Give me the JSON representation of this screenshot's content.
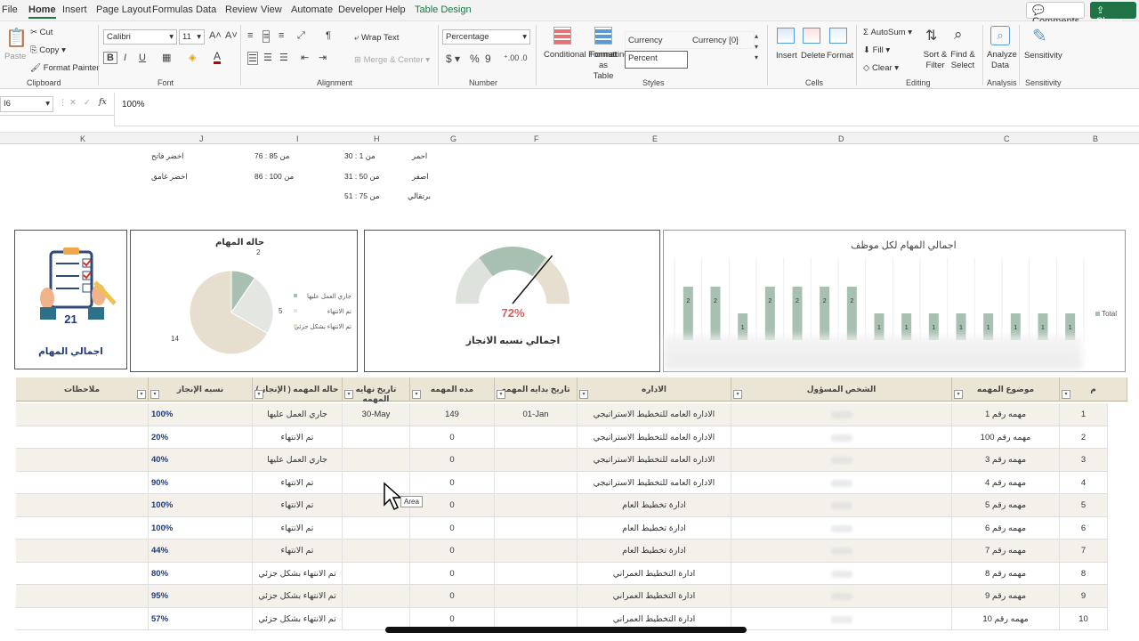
{
  "menu": {
    "tabs": [
      "File",
      "Home",
      "Insert",
      "Page Layout",
      "Formulas",
      "Data",
      "Review",
      "View",
      "Automate",
      "Developer",
      "Help",
      "Table Design"
    ],
    "comments": "Comments",
    "share": "Share"
  },
  "ribbon": {
    "clipboard": {
      "paste": "Paste",
      "cut": "Cut",
      "copy": "Copy",
      "format_painter": "Format Painter",
      "label": "Clipboard"
    },
    "font": {
      "name": "Calibri",
      "size": "11",
      "label": "Font"
    },
    "alignment": {
      "wrap": "Wrap Text",
      "merge": "Merge & Center",
      "label": "Alignment"
    },
    "number": {
      "format": "Percentage",
      "label": "Number"
    },
    "styles": {
      "conditional": "Conditional Formatting",
      "format_table": "Format as Table",
      "currency": "Currency",
      "currency0": "Currency [0]",
      "percent": "Percent",
      "label": "Styles"
    },
    "cells": {
      "insert": "Insert",
      "delete": "Delete",
      "format": "Format",
      "label": "Cells"
    },
    "editing": {
      "autosum": "AutoSum",
      "fill": "Fill",
      "clear": "Clear",
      "sort": "Sort & Filter",
      "find": "Find & Select",
      "label": "Editing"
    },
    "analysis": {
      "analyze": "Analyze Data",
      "label": "Analysis"
    },
    "sensitivity": {
      "btn": "Sensitivity",
      "label": "Sensitivity"
    }
  },
  "formula_bar": {
    "name_box": "I6",
    "fx": "fx",
    "value": "100%"
  },
  "columns": [
    "K",
    "J",
    "I",
    "H",
    "G",
    "F",
    "E",
    "D",
    "C",
    "B"
  ],
  "legend_ranges": {
    "red_label": "احمر",
    "red_range": "من 1 : 30",
    "yellow_label": "اصفر",
    "yellow_range": "من 50 : 31",
    "orange_label": "برتقالي",
    "orange_range": "من 75 : 51",
    "lightgreen_range": "من 85 : 76",
    "lightgreen_label": "اخضر فاتح",
    "darkgreen_range": "من 100 : 86",
    "darkgreen_label": "اخضر غامق"
  },
  "dashboard": {
    "total_tasks_value": "21",
    "total_tasks_label": "اجمالي المهام",
    "gauge_value": "72%",
    "gauge_title": "اجمالي نسبه الانجاز",
    "gauge_fraction": 0.72
  },
  "chart_data": [
    {
      "type": "pie",
      "title": "حاله المهام",
      "slices": [
        {
          "name": "جاري العمل عليها",
          "value": 2,
          "color": "#a8c0b2"
        },
        {
          "name": "تم الانتهاء",
          "value": 5,
          "color": "#e3e6e1"
        },
        {
          "name": "تم الانتهاء بشكل جزئي",
          "value": 14,
          "color": "#e6dfcf"
        }
      ]
    },
    {
      "type": "bar",
      "title": "اجمالي المهام لكل موظف",
      "series": [
        {
          "name": "Total",
          "values": [
            2,
            2,
            1,
            2,
            2,
            2,
            2,
            1,
            1,
            1,
            1,
            1,
            1,
            1,
            1
          ]
        }
      ],
      "color": "#a8c0b2"
    }
  ],
  "table": {
    "headers": {
      "notes": "ملاحظات",
      "pct": "نسبه الإنجاز",
      "status": "حاله المهمه ( الإنجاز )",
      "end": "تاريخ نهايه المهمه",
      "duration": "مده المهمه",
      "start": "تاريخ بدايه المهمه",
      "dept": "الاداره",
      "person": "الشخص المسؤول",
      "subject": "موضوع المهمه",
      "num": "م"
    },
    "rows": [
      {
        "pct": "100%",
        "status": "جاري العمل عليها",
        "end": "30-May",
        "duration": "149",
        "start": "01-Jan",
        "dept": "الاداره العامه للتخطيط الاستراتيجي",
        "subject": "مهمه رقم 1",
        "num": "1"
      },
      {
        "pct": "20%",
        "status": "تم الانتهاء",
        "end": "",
        "duration": "0",
        "start": "",
        "dept": "الاداره العامه للتخطيط الاستراتيجي",
        "subject": "مهمه رقم 100",
        "num": "2"
      },
      {
        "pct": "40%",
        "status": "جاري العمل عليها",
        "end": "",
        "duration": "0",
        "start": "",
        "dept": "الاداره العامه للتخطيط الاستراتيجي",
        "subject": "مهمه رقم 3",
        "num": "3"
      },
      {
        "pct": "90%",
        "status": "تم الانتهاء",
        "end": "",
        "duration": "0",
        "start": "",
        "dept": "الاداره العامه للتخطيط الاستراتيجي",
        "subject": "مهمه رقم 4",
        "num": "4"
      },
      {
        "pct": "100%",
        "status": "تم الانتهاء",
        "end": "",
        "duration": "0",
        "start": "",
        "dept": "ادارة تخطيط العام",
        "subject": "مهمه رقم 5",
        "num": "5"
      },
      {
        "pct": "100%",
        "status": "تم الانتهاء",
        "end": "",
        "duration": "0",
        "start": "",
        "dept": "ادارة تخطيط العام",
        "subject": "مهمه رقم 6",
        "num": "6"
      },
      {
        "pct": "44%",
        "status": "تم الانتهاء",
        "end": "",
        "duration": "0",
        "start": "",
        "dept": "ادارة تخطيط العام",
        "subject": "مهمه رقم 7",
        "num": "7"
      },
      {
        "pct": "80%",
        "status": "تم الانتهاء بشكل جزئي",
        "end": "",
        "duration": "0",
        "start": "",
        "dept": "ادارة التخطيط العمراني",
        "subject": "مهمه رقم 8",
        "num": "8"
      },
      {
        "pct": "95%",
        "status": "تم الانتهاء بشكل جزئي",
        "end": "",
        "duration": "0",
        "start": "",
        "dept": "ادارة التخطيط العمراني",
        "subject": "مهمه رقم 9",
        "num": "9"
      },
      {
        "pct": "57%",
        "status": "تم الانتهاء بشكل جزئي",
        "end": "",
        "duration": "0",
        "start": "",
        "dept": "ادارة التخطيط العمراني",
        "subject": "مهمه رقم 10",
        "num": "10"
      }
    ]
  },
  "tooltip": "Area",
  "colors": {
    "excel_green": "#217346",
    "header_beige": "#ebe5d6",
    "chart_green": "#a8c0b2",
    "pct_blue": "#1f3a7a"
  }
}
